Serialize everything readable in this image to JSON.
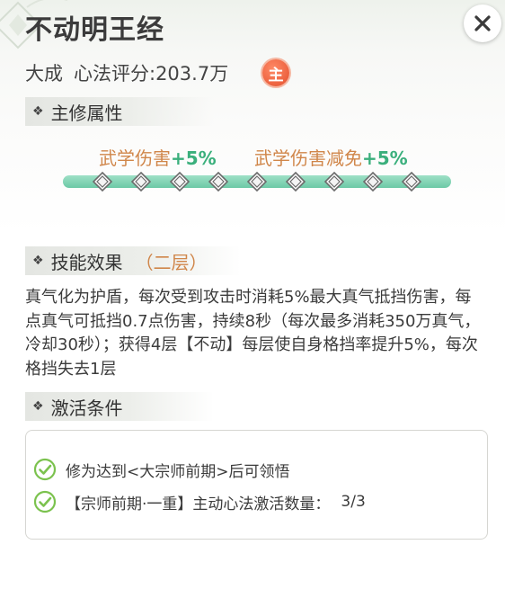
{
  "title": "不动明王经",
  "close_icon": "close-icon",
  "rank": "大成",
  "score_label": "心法评分:203.7万",
  "badge": "主",
  "colors": {
    "accent_orange": "#d0864a",
    "accent_green": "#3aaf7c",
    "bar_green": "#6cc9a6",
    "badge_red": "#e4502e"
  },
  "main_attr": {
    "header": "主修属性",
    "bonuses": [
      {
        "name": "武学伤害",
        "value": "+5%"
      },
      {
        "name": "武学伤害减免",
        "value": "+5%"
      }
    ],
    "gem_count": 9
  },
  "skill": {
    "header": "技能效果",
    "level": "（二层）",
    "description": "真气化为护盾，每次受到攻击时消耗5%最大真气抵挡伤害，每点真气可抵挡0.7点伤害，持续8秒（每次最多消耗350万真气，冷却30秒）；获得4层【不动】每层使自身格挡率提升5%，每次格挡失去1层"
  },
  "activation": {
    "header": "激活条件",
    "conditions": [
      {
        "text": "修为达到<大宗师前期>后可领悟",
        "count": "",
        "met": true
      },
      {
        "text": "【宗师前期·一重】主动心法激活数量：",
        "count": "3/3",
        "met": true
      }
    ]
  }
}
